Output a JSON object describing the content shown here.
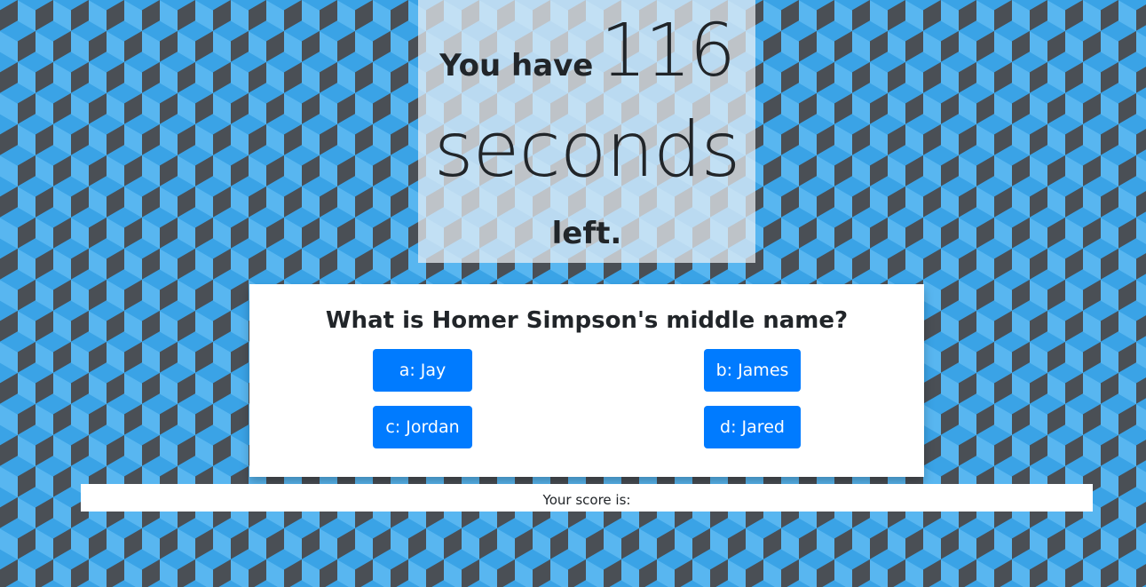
{
  "timer": {
    "prefix": "You have",
    "seconds_left": "116",
    "unit": "seconds",
    "suffix": "left."
  },
  "quiz": {
    "question": "What is Homer Simpson's middle name?",
    "answers": [
      {
        "label": "a: Jay"
      },
      {
        "label": "b: James"
      },
      {
        "label": "c: Jordan"
      },
      {
        "label": "d: Jared"
      }
    ]
  },
  "score": {
    "label": "Your score is:"
  },
  "colors": {
    "button": "#007bff",
    "cube_light": "#58b6f0",
    "cube_mid": "#3aa3e6",
    "cube_dark": "#4a4f55"
  }
}
